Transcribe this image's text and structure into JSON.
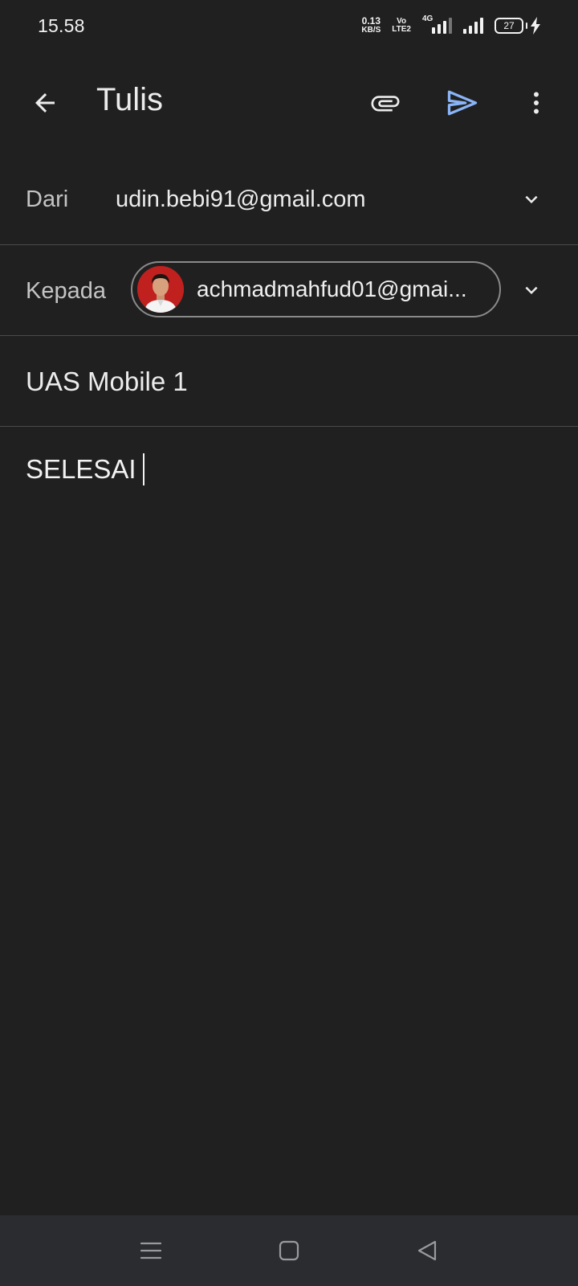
{
  "status_bar": {
    "time": "15.58",
    "net_speed_value": "0.13",
    "net_speed_unit": "KB/S",
    "volte_top": "Vo",
    "volte_bottom": "LTE2",
    "network_type": "4G",
    "battery_level": "27"
  },
  "app_bar": {
    "title": "Tulis",
    "back_icon": "arrow-left-icon",
    "attach_icon": "paperclip-icon",
    "send_icon": "send-icon",
    "more_icon": "more-vert-icon"
  },
  "compose": {
    "from_label": "Dari",
    "from_value": "udin.bebi91@gmail.com",
    "to_label": "Kepada",
    "to_chip": "achmadmahfud01@gmai...",
    "subject": "UAS Mobile 1",
    "body": "SELESAI"
  },
  "colors": {
    "background": "#202020",
    "send_accent": "#8ab4f8",
    "divider": "#4a4a4a",
    "nav_bar": "#2b2c30",
    "avatar_bg": "#c0201e"
  }
}
